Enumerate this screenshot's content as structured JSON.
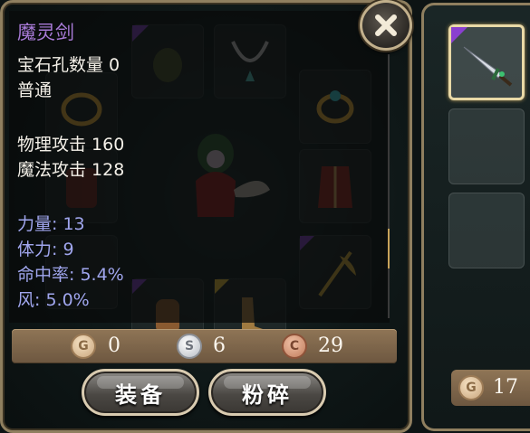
{
  "tooltip": {
    "item_name": "魔灵剑",
    "gem_sockets": "宝石孔数量 0",
    "quality": "普通",
    "physical_attack": "物理攻击 160",
    "magic_attack": "魔法攻击 128",
    "bonuses": [
      "力量: 13",
      "体力: 9",
      "命中率: 5.4%",
      "风: 5.0%"
    ]
  },
  "currency": {
    "gold_icon": "G",
    "gold_value": "0",
    "silver_icon": "S",
    "silver_value": "6",
    "copper_icon": "C",
    "copper_value": "29"
  },
  "buttons": {
    "equip_label": "装备",
    "smash_label": "粉碎"
  },
  "right_panel": {
    "gold_icon": "G",
    "gold_total": "17"
  },
  "scroll": {
    "position_fraction": 0.78
  },
  "colors": {
    "item_name": "#a97bd8",
    "bonus_stat": "#a0a6ee",
    "frame": "#8f7f5f",
    "currency_bar": "#7d6549"
  },
  "icons": {
    "close": "close-icon",
    "character": "character-portrait",
    "selected_item": "sword-icon"
  }
}
